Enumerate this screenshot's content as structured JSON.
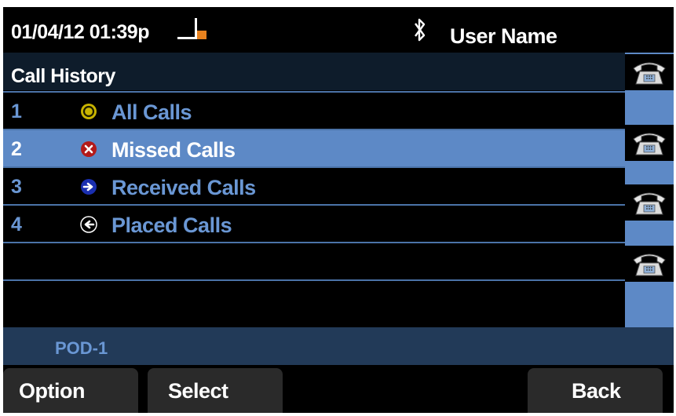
{
  "status": {
    "datetime": "01/04/12 01:39p",
    "user_name": "User Name",
    "offhook_icon": "offhook-icon",
    "bluetooth_icon": "bluetooth-icon"
  },
  "title": "Call History",
  "list": [
    {
      "number": "1",
      "label": "All Calls",
      "icon": "all-calls-icon",
      "icon_color": "#c9b400"
    },
    {
      "number": "2",
      "label": "Missed Calls",
      "icon": "missed-calls-icon",
      "icon_color": "#b31a1a",
      "selected": true
    },
    {
      "number": "3",
      "label": "Received Calls",
      "icon": "received-calls-icon",
      "icon_color": "#1a2fb0"
    },
    {
      "number": "4",
      "label": "Placed Calls",
      "icon": "placed-calls-icon",
      "icon_color": "#000000"
    }
  ],
  "line_keys": [
    "phone-icon",
    "phone-icon",
    "phone-icon",
    "phone-icon"
  ],
  "pod_label": "POD-1",
  "softkeys": {
    "option": "Option",
    "select": "Select",
    "back": "Back"
  },
  "colors": {
    "accent": "#5d89c6",
    "text_blue": "#6a97d4",
    "pod_bar": "#223a58"
  }
}
